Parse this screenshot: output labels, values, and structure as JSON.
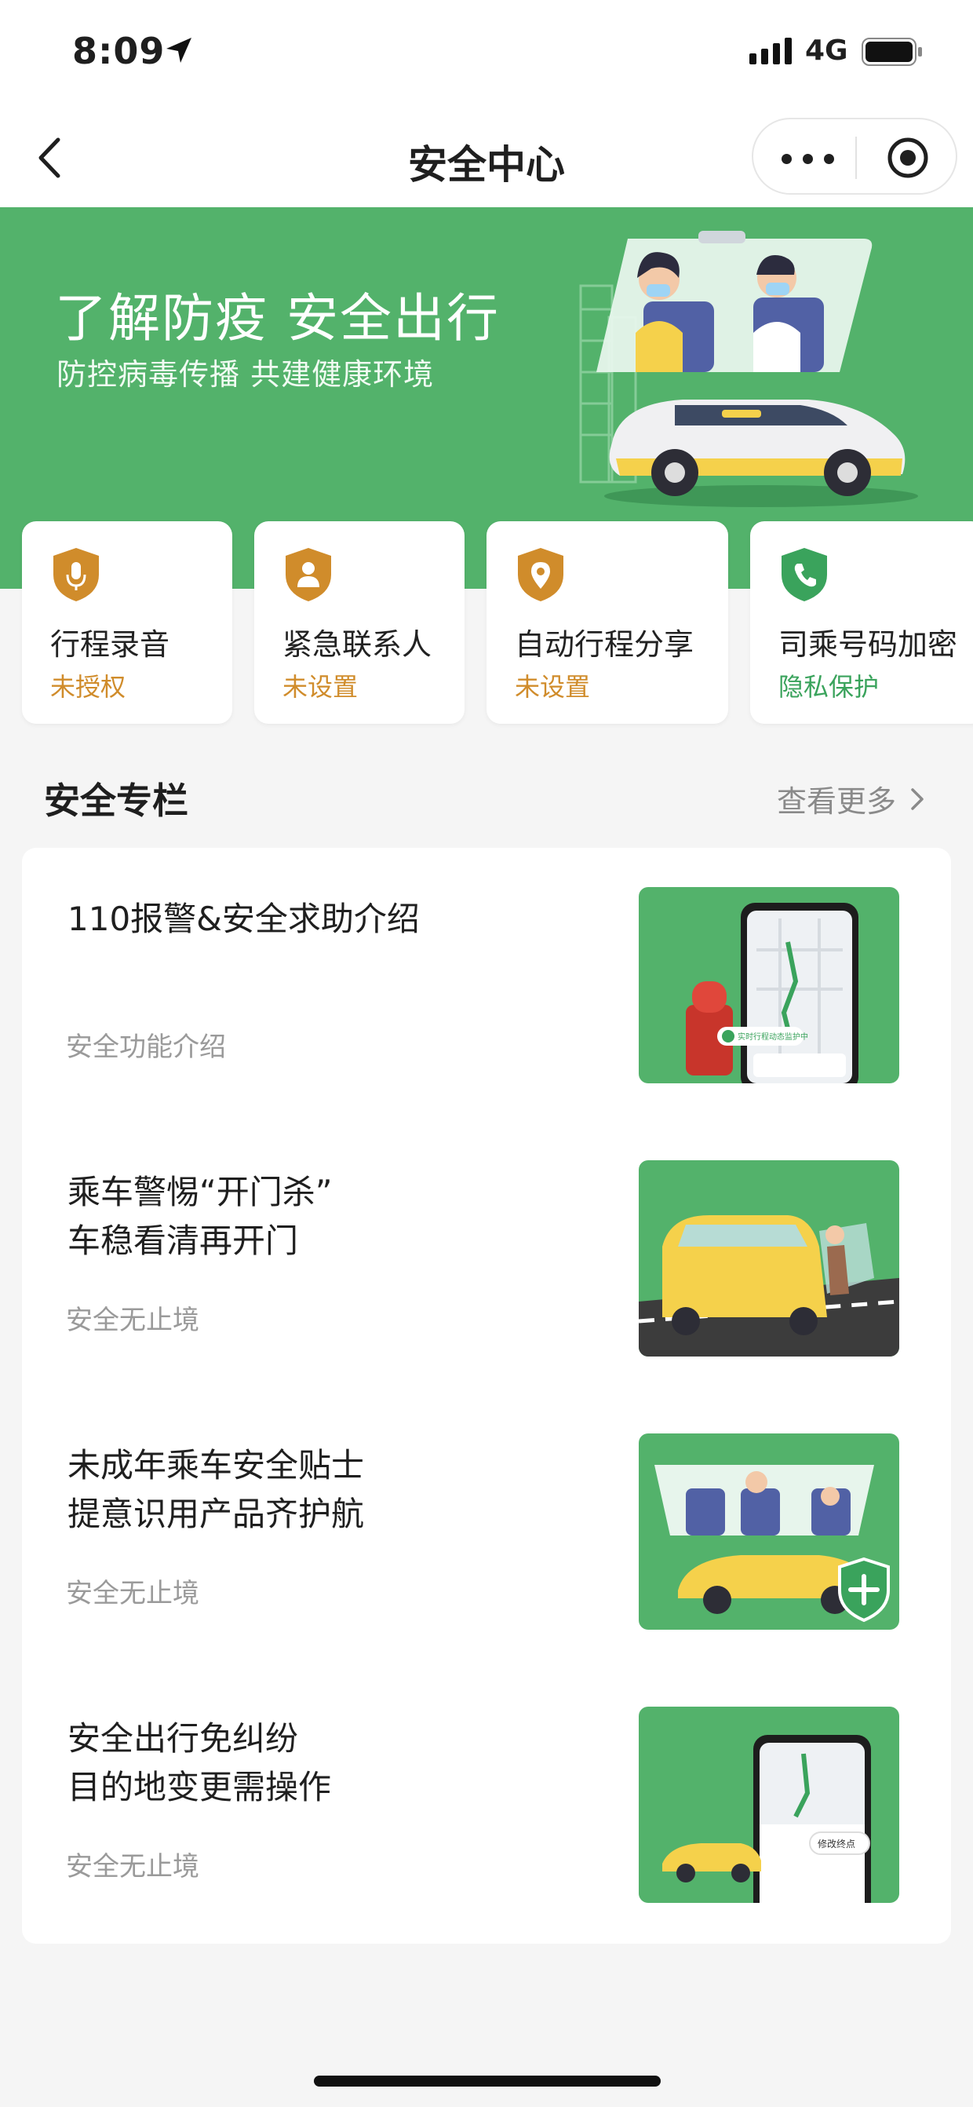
{
  "status_bar": {
    "time": "8:09",
    "network": "4G"
  },
  "nav": {
    "title": "安全中心"
  },
  "banner": {
    "title": "了解防疫 安全出行",
    "subtitle": "防控病毒传播 共建健康环境"
  },
  "features": [
    {
      "label": "行程录音",
      "status": "未授权",
      "icon": "microphone-icon",
      "color": "#d08c2b"
    },
    {
      "label": "紧急联系人",
      "status": "未设置",
      "icon": "person-icon",
      "color": "#d08c2b"
    },
    {
      "label": "自动行程分享",
      "status": "未设置",
      "icon": "location-pin-icon",
      "color": "#d08c2b"
    },
    {
      "label": "司乘号码加密",
      "status": "隐私保护",
      "icon": "phone-icon",
      "color": "#3aa35c"
    }
  ],
  "section": {
    "title": "安全专栏",
    "more": "查看更多"
  },
  "articles": [
    {
      "title_line1": "110报警&安全求助介绍",
      "title_line2": "",
      "tag": "安全功能介绍",
      "thumb_badge": "实时行程动态监护中"
    },
    {
      "title_line1": "乘车警惕“开门杀”",
      "title_line2": "车稳看清再开门",
      "tag": "安全无止境"
    },
    {
      "title_line1": "未成年乘车安全贴士",
      "title_line2": "提意识用产品齐护航",
      "tag": "安全无止境"
    },
    {
      "title_line1": "安全出行免纠纷",
      "title_line2": "目的地变更需操作",
      "tag": "安全无止境",
      "thumb_badge": "修改终点"
    }
  ],
  "colors": {
    "brand_green": "#53b26b",
    "warning_orange": "#d08c2b",
    "safe_green": "#3aa35c"
  }
}
